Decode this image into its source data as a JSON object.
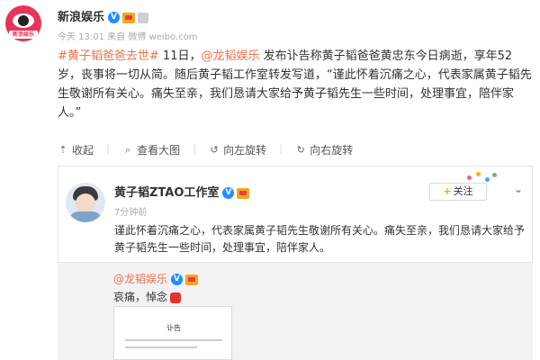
{
  "post": {
    "author": "新浪娱乐",
    "avatar_label": "新浪娱乐",
    "meta": "今天 13:01 来自 微博 weibo.com",
    "body": {
      "hashtag": "#黄子韬爸爸去世#",
      "part1": " 11日，",
      "mention": "@龙韬娱乐",
      "part2": " 发布讣告称黄子韬爸爸黄忠东今日病逝，享年52岁，丧事将一切从简。随后黄子韬工作室转发写道，“谨此怀着沉痛之心，代表家属黄子韬先生敬谢所有关心。痛失至亲，我们恳请大家给予黄子韬先生一些时间，处理事宜，陪伴家人。”"
    },
    "toolbar": {
      "collect": "收起",
      "view_large": "查看大图",
      "rotate_left": "向左旋转",
      "rotate_right": "向右旋转"
    }
  },
  "repost": {
    "author": "黄子韬ZTAO工作室",
    "time": "7分钟前",
    "follow_label": "关注",
    "body": "谨此怀着沉痛之心，代表家属黄子韬先生敬谢所有关心。痛失至亲，我们恳请大家给予黄子韬先生一些时间，处理事宜，陪伴家人。",
    "inner": {
      "author": "@龙韬娱乐",
      "text": "哀痛，悼念"
    },
    "document_title": "讣告"
  },
  "icons": {
    "verified": "verified-badge-icon",
    "crown": "vip-crown-icon",
    "collect": "collapse-icon",
    "zoom": "zoom-icon",
    "rotate_left": "rotate-left-icon",
    "rotate_right": "rotate-right-icon",
    "chevron": "chevron-down-icon"
  },
  "colors": {
    "link": "#eb7350",
    "verified": "#1e90ff",
    "brand_avatar": "#e6345a"
  }
}
